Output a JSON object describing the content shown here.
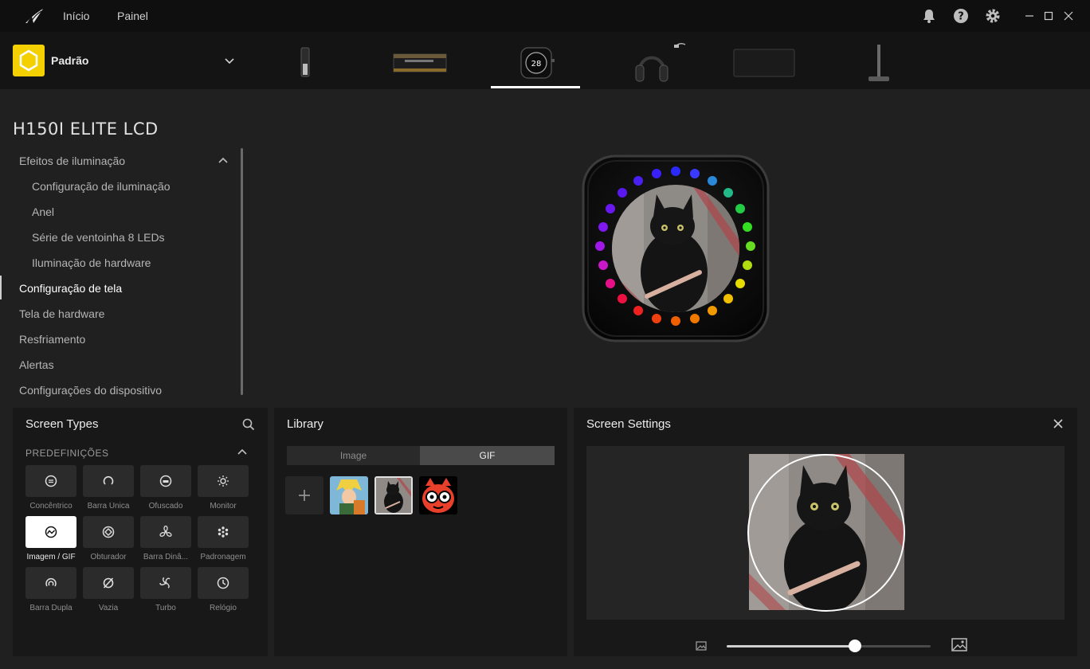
{
  "titlebar": {
    "nav": [
      "Início",
      "Painel"
    ]
  },
  "profile": {
    "name": "Padrão"
  },
  "devices": [
    "usb-stick-device",
    "ram-device",
    "cooler-lcd-device",
    "headset-device",
    "mousepad-device",
    "headset-stand-device"
  ],
  "device_lcd_value": "28",
  "device": {
    "title": "H150I ELITE LCD"
  },
  "menu": {
    "items": [
      "Efeitos de iluminação",
      "Configuração de iluminação",
      "Anel",
      "Série de ventoinha 8 LEDs",
      "Iluminação de hardware",
      "Configuração de tela",
      "Tela de hardware",
      "Resfriamento",
      "Alertas",
      "Configurações do dispositivo"
    ]
  },
  "screen_types": {
    "title": "Screen Types",
    "section": "PREDEFINIÇÕES",
    "tiles": [
      "Concêntrico",
      "Barra Única",
      "Ofuscado",
      "Monitor",
      "Imagem / GIF",
      "Obturador",
      "Barra Dinâ...",
      "Padronagem",
      "Barra Dupla",
      "Vazia",
      "Turbo",
      "Relógio"
    ],
    "selected": "Imagem / GIF"
  },
  "library": {
    "title": "Library",
    "tabs": [
      "Image",
      "GIF"
    ],
    "active_tab": "GIF"
  },
  "screen_settings": {
    "title": "Screen Settings",
    "zoom": 0.63
  },
  "colors": {
    "accent": "#f4d000",
    "panel": "#181818",
    "background": "#202020"
  }
}
